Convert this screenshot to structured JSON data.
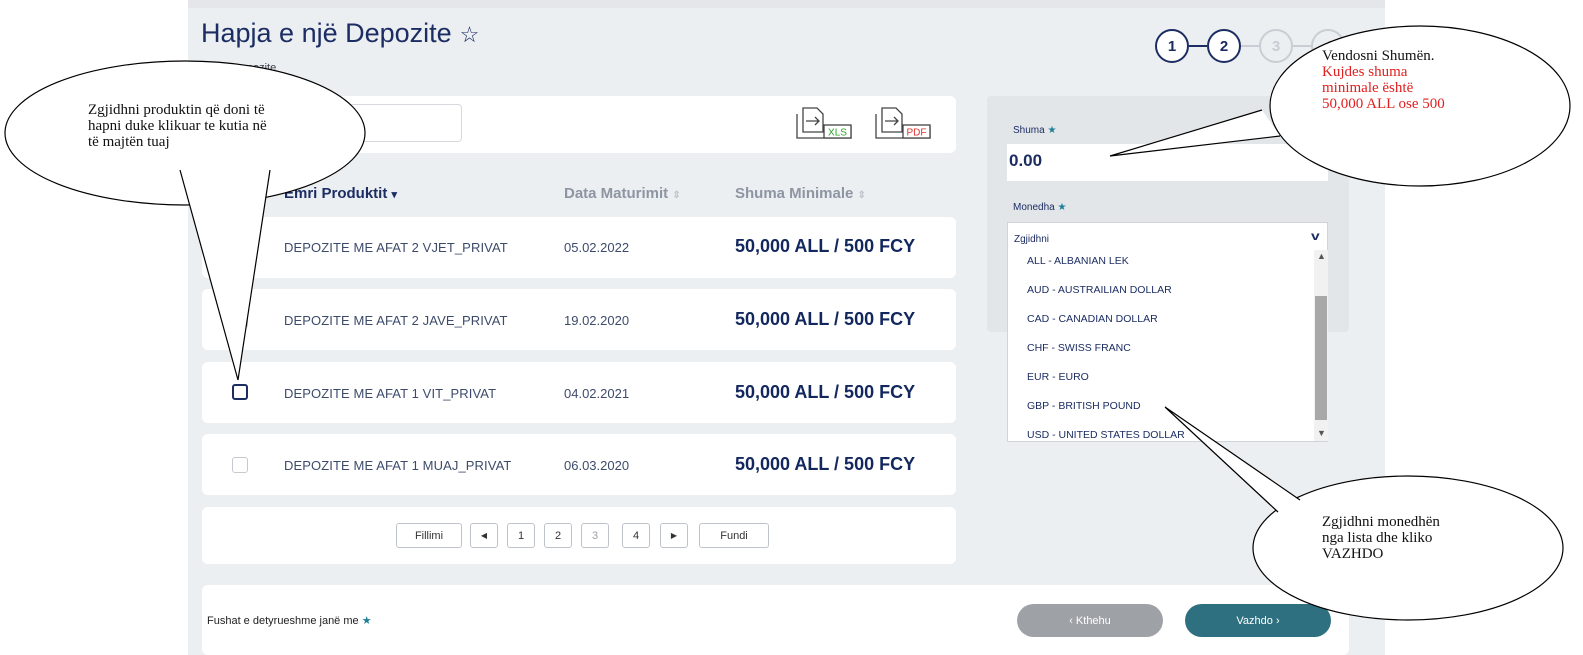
{
  "header": {
    "title": "Hapja e një Depozite",
    "subtitle": "Hapje Depozite"
  },
  "stepper": {
    "steps": [
      "1",
      "2",
      "3",
      "4"
    ],
    "current": 2
  },
  "toolbar": {
    "export_xls": "XLS",
    "export_pdf": "PDF"
  },
  "table": {
    "columns": [
      "Emri Produktit",
      "Data Maturimit",
      "Shuma Minimale"
    ],
    "rows": [
      {
        "product": "DEPOZITE ME AFAT 2 VJET_PRIVAT",
        "date": "05.02.2022",
        "amount": "50,000 ALL / 500 FCY",
        "checked": false
      },
      {
        "product": "DEPOZITE ME AFAT 2 JAVE_PRIVAT",
        "date": "19.02.2020",
        "amount": "50,000 ALL / 500 FCY",
        "checked": false
      },
      {
        "product": "DEPOZITE ME AFAT 1 VIT_PRIVAT",
        "date": "04.02.2021",
        "amount": "50,000 ALL / 500 FCY",
        "checked": true
      },
      {
        "product": "DEPOZITE ME AFAT 1 MUAJ_PRIVAT",
        "date": "06.03.2020",
        "amount": "50,000 ALL / 500 FCY",
        "checked": false
      }
    ]
  },
  "pagination": {
    "first": "Fillimi",
    "last": "Fundi",
    "pages": [
      "1",
      "2",
      "3",
      "4"
    ]
  },
  "form": {
    "amount_label": "Shuma",
    "amount_value": "0.00",
    "currency_label": "Monedha",
    "currency_selected": "Zgjidhni",
    "currency_options": [
      "ALL - ALBANIAN LEK",
      "AUD - AUSTRAILIAN DOLLAR",
      "CAD - CANADIAN DOLLAR",
      "CHF - SWISS FRANC",
      "EUR - EURO",
      "GBP - BRITISH POUND",
      "USD - UNITED STATES DOLLAR"
    ]
  },
  "footer": {
    "required_note": "Fushat e detyrueshme janë me",
    "back_label": "‹ Kthehu",
    "next_label": "Vazhdo ›"
  },
  "callouts": {
    "left": [
      "Zgjidhni produktin që doni të",
      "hapni duke klikuar te kutia në",
      "të majtën tuaj"
    ],
    "top_right_line1": "Vendosni Shumën.",
    "top_right_red": [
      "Kujdes shuma",
      "minimale është",
      "50,000 ALL ose 500"
    ],
    "bottom_right": [
      "Zgjidhni monedhën",
      "nga lista dhe kliko",
      "VAZHDO"
    ]
  },
  "colors": {
    "primary": "#1c2d63",
    "next_button": "#2f7080",
    "back_button": "#9ea2a6",
    "required_star": "#1e7f98",
    "warning_text": "#e02020"
  }
}
